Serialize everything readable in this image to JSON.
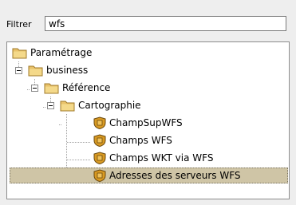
{
  "filter": {
    "label": "Filtrer",
    "value": "wfs"
  },
  "tree": {
    "nodes": [
      {
        "label": "Paramétrage",
        "type": "folder"
      },
      {
        "label": "business",
        "type": "folder"
      },
      {
        "label": "Référence",
        "type": "folder"
      },
      {
        "label": "Cartographie",
        "type": "folder"
      },
      {
        "label": "ChampSupWFS",
        "type": "shield"
      },
      {
        "label": "Champs WFS",
        "type": "shield"
      },
      {
        "label": "Champs WKT via WFS",
        "type": "shield"
      },
      {
        "label": "Adresses des serveurs WFS",
        "type": "shield",
        "selected": true
      }
    ]
  },
  "colors": {
    "selection": "#cfc5a6",
    "folder": "#e9c26a",
    "shield": "#c58a1c"
  }
}
